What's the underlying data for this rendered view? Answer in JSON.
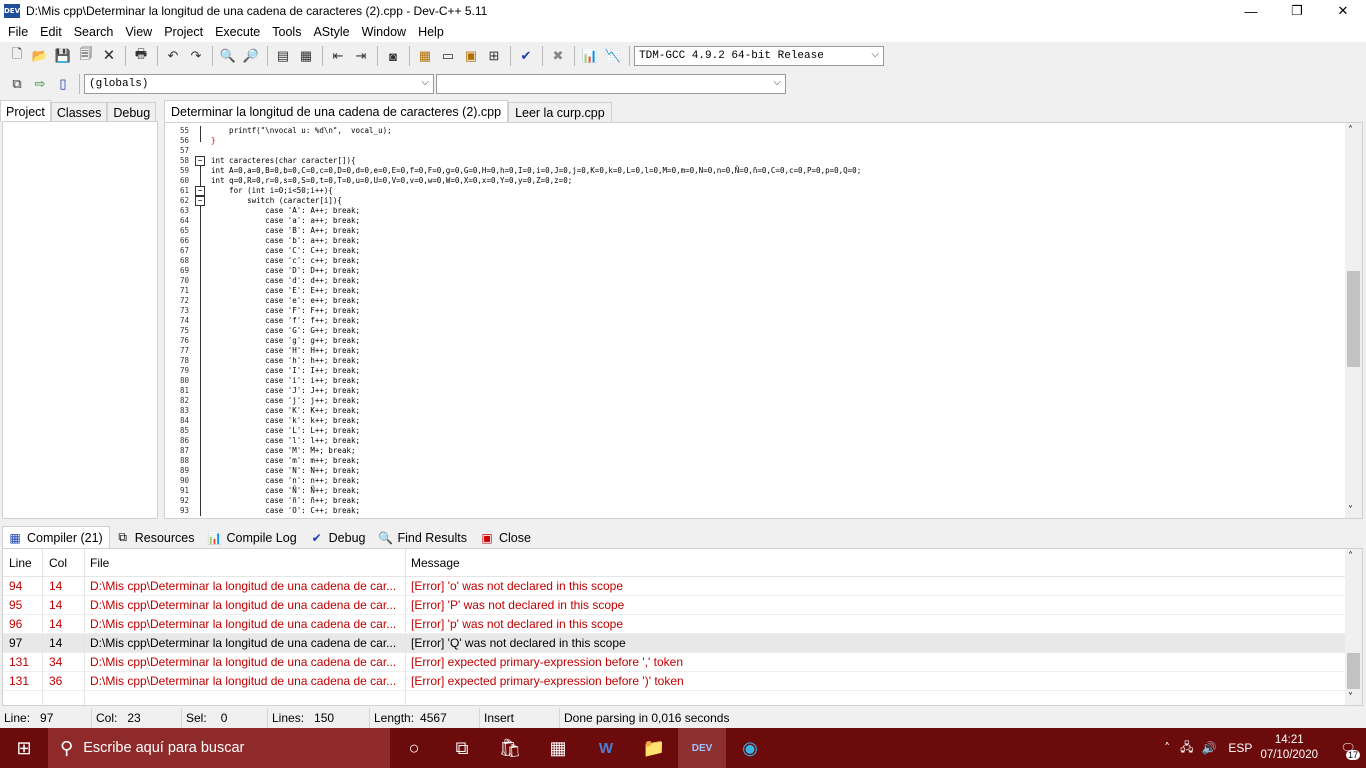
{
  "window": {
    "title": "D:\\Mis cpp\\Determinar la longitud de una cadena de caracteres (2).cpp - Dev-C++ 5.11",
    "app_icon_text": "DEV",
    "minimize": "—",
    "maximize": "❐",
    "close": "✕"
  },
  "menu": [
    "File",
    "Edit",
    "Search",
    "View",
    "Project",
    "Execute",
    "Tools",
    "AStyle",
    "Window",
    "Help"
  ],
  "toolbar": {
    "compiler": "TDM-GCC 4.9.2 64-bit Release",
    "scope": "(globals)",
    "symbol": ""
  },
  "left_tabs": [
    "Project",
    "Classes",
    "Debug"
  ],
  "editor_tabs": [
    "Determinar la longitud de una cadena de caracteres (2).cpp",
    "Leer la curp.cpp"
  ],
  "code": [
    {
      "n": "55",
      "t": "    printf(\"\\nvocal u: %d\\n\",  vocal_u);"
    },
    {
      "n": "56",
      "t": "}"
    },
    {
      "n": "57",
      "t": ""
    },
    {
      "n": "58",
      "t": "int caracteres(char caracter[]){"
    },
    {
      "n": "59",
      "t": "int A=0,a=0,B=0,b=0,C=0,c=0,D=0,d=0,e=0,E=0,f=0,F=0,g=0,G=0,H=0,h=0,I=0,i=0,J=0,j=0,K=0,k=0,L=0,l=0,M=0,m=0,N=0,n=0,Ñ=0,ñ=0,C=0,c=0,P=0,p=0,Q=0;"
    },
    {
      "n": "60",
      "t": "int q=0,R=0,r=0,s=0,S=0,t=0,T=0,u=0,U=0,V=0,v=0,w=0,W=0,X=0,x=0,Y=0,y=0,Z=0,z=0;"
    },
    {
      "n": "61",
      "t": "    for (int i=0;i<50;i++){"
    },
    {
      "n": "62",
      "t": "        switch (caracter[i]){"
    },
    {
      "n": "63",
      "t": "            case 'A': A++; break;"
    },
    {
      "n": "64",
      "t": "            case 'a': a++; break;"
    },
    {
      "n": "65",
      "t": "            case 'B': A++; break;"
    },
    {
      "n": "66",
      "t": "            case 'b': a++; break;"
    },
    {
      "n": "67",
      "t": "            case 'C': C++; break;"
    },
    {
      "n": "68",
      "t": "            case 'c': c++; break;"
    },
    {
      "n": "69",
      "t": "            case 'D': D++; break;"
    },
    {
      "n": "70",
      "t": "            case 'd': d++; break;"
    },
    {
      "n": "71",
      "t": "            case 'E': E++; break;"
    },
    {
      "n": "72",
      "t": "            case 'e': e++; break;"
    },
    {
      "n": "73",
      "t": "            case 'F': F++; break;"
    },
    {
      "n": "74",
      "t": "            case 'f': f++; break;"
    },
    {
      "n": "75",
      "t": "            case 'G': G++; break;"
    },
    {
      "n": "76",
      "t": "            case 'g': g++; break;"
    },
    {
      "n": "77",
      "t": "            case 'H': H++; break;"
    },
    {
      "n": "78",
      "t": "            case 'h': h++; break;"
    },
    {
      "n": "79",
      "t": "            case 'I': I++; break;"
    },
    {
      "n": "80",
      "t": "            case 'i': i++; break;"
    },
    {
      "n": "81",
      "t": "            case 'J': J++; break;"
    },
    {
      "n": "82",
      "t": "            case 'j': j++; break;"
    },
    {
      "n": "83",
      "t": "            case 'K': K++; break;"
    },
    {
      "n": "84",
      "t": "            case 'k': k++; break;"
    },
    {
      "n": "85",
      "t": "            case 'L': L++; break;"
    },
    {
      "n": "86",
      "t": "            case 'l': l++; break;"
    },
    {
      "n": "87",
      "t": "            case 'M': M+; break;"
    },
    {
      "n": "88",
      "t": "            case 'm': m++; break;"
    },
    {
      "n": "89",
      "t": "            case 'N': N++; break;"
    },
    {
      "n": "90",
      "t": "            case 'n': n++; break;"
    },
    {
      "n": "91",
      "t": "            case 'Ñ': Ñ++; break;"
    },
    {
      "n": "92",
      "t": "            case 'ñ': ñ++; break;"
    },
    {
      "n": "93",
      "t": "            case 'O': C++; break;"
    }
  ],
  "bottom_tabs": [
    "Compiler (21)",
    "Resources",
    "Compile Log",
    "Debug",
    "Find Results",
    "Close"
  ],
  "results": {
    "headers": [
      "Line",
      "Col",
      "File",
      "Message"
    ],
    "rows": [
      {
        "line": "94",
        "col": "14",
        "file": "D:\\Mis cpp\\Determinar la longitud de una cadena de car...",
        "msg": "[Error] 'o' was not declared in this scope"
      },
      {
        "line": "95",
        "col": "14",
        "file": "D:\\Mis cpp\\Determinar la longitud de una cadena de car...",
        "msg": "[Error] 'P' was not declared in this scope"
      },
      {
        "line": "96",
        "col": "14",
        "file": "D:\\Mis cpp\\Determinar la longitud de una cadena de car...",
        "msg": "[Error] 'p' was not declared in this scope"
      },
      {
        "line": "97",
        "col": "14",
        "file": "D:\\Mis cpp\\Determinar la longitud de una cadena de car...",
        "msg": "[Error] 'Q' was not declared in this scope"
      },
      {
        "line": "131",
        "col": "34",
        "file": "D:\\Mis cpp\\Determinar la longitud de una cadena de car...",
        "msg": "[Error] expected primary-expression before ',' token"
      },
      {
        "line": "131",
        "col": "36",
        "file": "D:\\Mis cpp\\Determinar la longitud de una cadena de car...",
        "msg": "[Error] expected primary-expression before ')' token"
      },
      {
        "line": "",
        "col": "",
        "file": "",
        "msg": ""
      }
    ],
    "selected_index": 3
  },
  "status": {
    "line_label": "Line:",
    "line": "97",
    "col_label": "Col:",
    "col": "23",
    "sel_label": "Sel:",
    "sel": "0",
    "lines_label": "Lines:",
    "lines": "150",
    "length_label": "Length:",
    "length": "4567",
    "mode": "Insert",
    "message": "Done parsing in 0,016 seconds"
  },
  "taskbar": {
    "search_placeholder": "Escribe aquí para buscar",
    "lang": "ESP",
    "time": "14:21",
    "date": "07/10/2020",
    "notifications": "17"
  },
  "colors": {
    "error": "#c00000",
    "taskbar": "#6b0b0b",
    "keyword": "#000000",
    "string": "#0000ff"
  }
}
